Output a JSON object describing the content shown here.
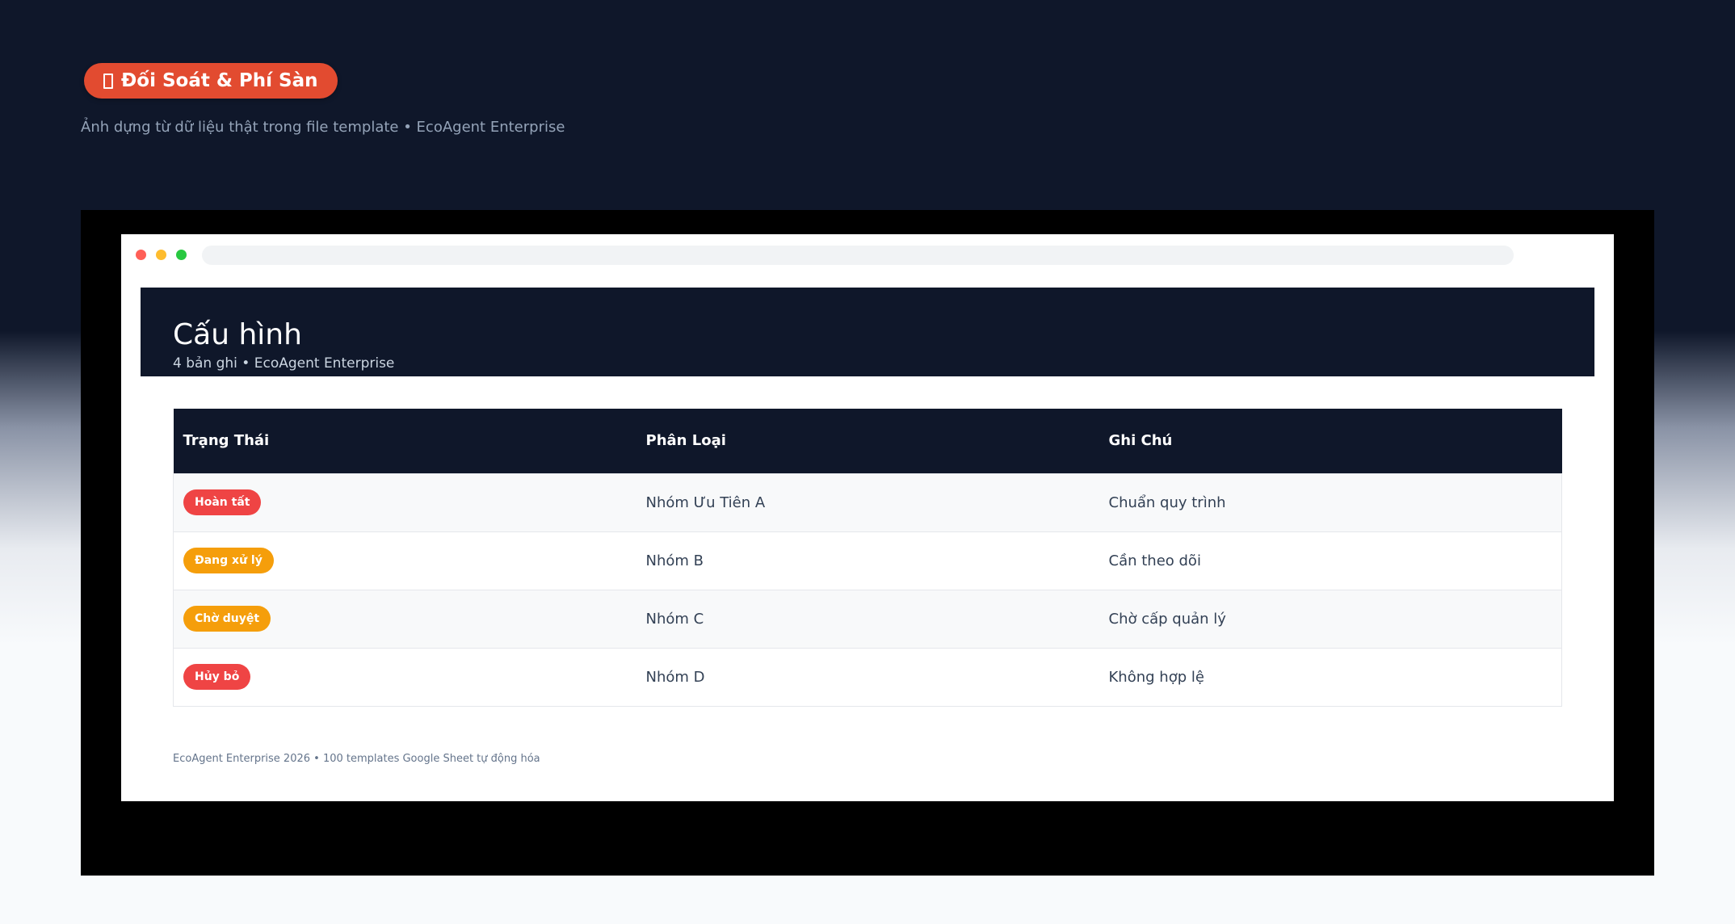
{
  "hero": {
    "badge_label": "Đối Soát & Phí Sàn",
    "subtitle": "Ảnh dựng từ dữ liệu thật trong file template • EcoAgent Enterprise"
  },
  "page": {
    "title": "Cấu hình",
    "subtitle": "4 bản ghi • EcoAgent Enterprise"
  },
  "table": {
    "headers": [
      "Trạng Thái",
      "Phân Loại",
      "Ghi Chú"
    ],
    "rows": [
      {
        "status": "Hoàn tất",
        "status_color": "#ef4444",
        "category": "Nhóm Ưu Tiên A",
        "note": "Chuẩn quy trình"
      },
      {
        "status": "Đang xử lý",
        "status_color": "#f59e0b",
        "category": "Nhóm B",
        "note": "Cần theo dõi"
      },
      {
        "status": "Chờ duyệt",
        "status_color": "#f59e0b",
        "category": "Nhóm C",
        "note": "Chờ cấp quản lý"
      },
      {
        "status": "Hủy bỏ",
        "status_color": "#ef4444",
        "category": "Nhóm D",
        "note": "Không hợp lệ"
      }
    ]
  },
  "footer": {
    "text": "EcoAgent Enterprise 2026 • 100 templates Google Sheet tự động hóa"
  },
  "colors": {
    "hero_badge": "#e24b30",
    "header_bg": "#0f172a"
  },
  "icons": {
    "hero_badge_icon": "missing-glyph-icon"
  }
}
